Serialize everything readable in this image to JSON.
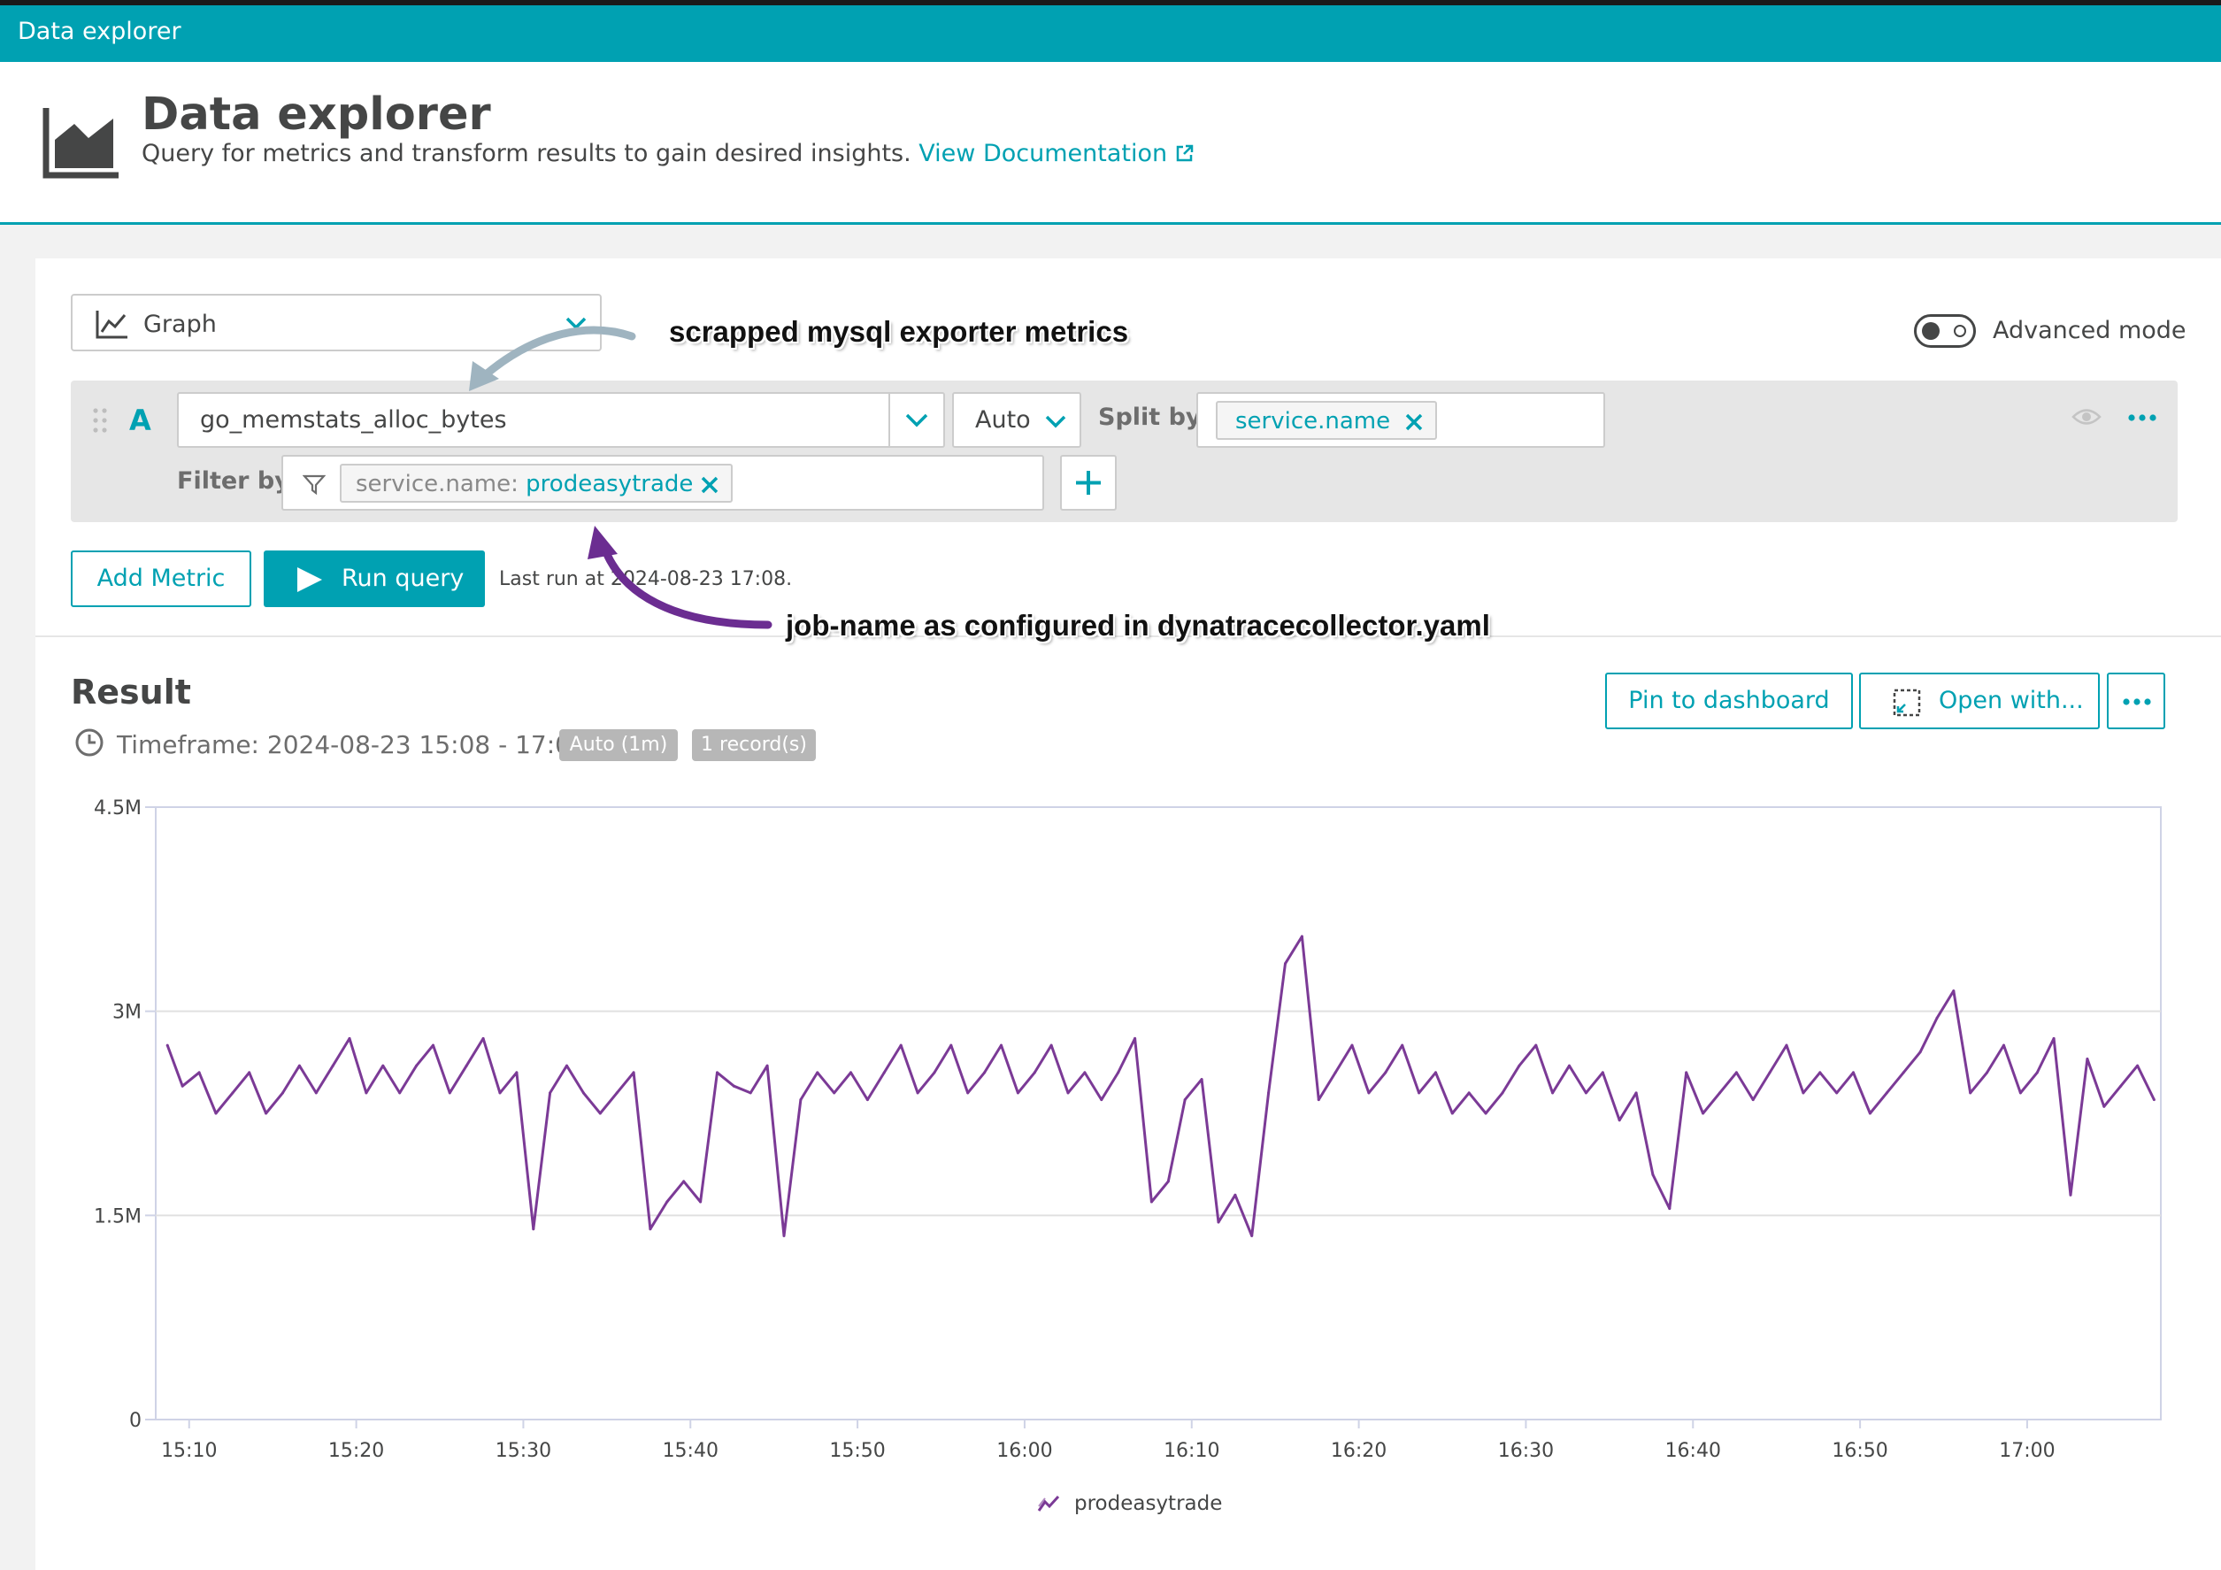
{
  "topbar": {
    "title": "Data explorer"
  },
  "header": {
    "title": "Data explorer",
    "description": "Query for metrics and transform results to gain desired insights.",
    "doc_link": "View Documentation"
  },
  "toolbar": {
    "visualization": "Graph",
    "advanced_mode_label": "Advanced mode",
    "advanced_mode_on": true
  },
  "query": {
    "letter": "A",
    "metric": "go_memstats_alloc_bytes",
    "aggregation": "Auto",
    "split_by_label": "Split by",
    "split_by_value": "service.name",
    "filter_label": "Filter by",
    "filter_key": "service.name:",
    "filter_value": "prodeasytrade"
  },
  "actions": {
    "add_metric": "Add Metric",
    "run_query": "Run query",
    "last_run": "Last run at 2024-08-23 17:08."
  },
  "annotations": {
    "metric_note": "scrapped mysql exporter metrics",
    "filter_note": "job-name as configured in dynatracecollector.yaml"
  },
  "result": {
    "title": "Result",
    "timeframe": "Timeframe: 2024-08-23 15:08 - 17:08",
    "badge_resolution": "Auto (1m)",
    "badge_records": "1 record(s)",
    "pin_button": "Pin to dashboard",
    "open_button": "Open with..."
  },
  "colors": {
    "accent": "#00a1b2",
    "series": "#7b3a96",
    "annotation_arrow_gray": "#9fb4c0",
    "annotation_arrow_purple": "#6b2d91"
  },
  "chart_data": {
    "type": "line",
    "xlabel": "",
    "ylabel": "",
    "y_ticks": [
      "0",
      "1.5M",
      "3M",
      "4.5M"
    ],
    "y_tick_values": [
      0,
      1500000,
      3000000,
      4500000
    ],
    "ylim": [
      0,
      4500000
    ],
    "x_ticks": [
      "15:10",
      "15:20",
      "15:30",
      "15:40",
      "15:50",
      "16:00",
      "16:10",
      "16:20",
      "16:30",
      "16:40",
      "16:50",
      "17:00"
    ],
    "x_tick_minutes": [
      2,
      12,
      22,
      32,
      42,
      52,
      62,
      72,
      82,
      92,
      102,
      112
    ],
    "x_unit_note": "minutes after 15:08",
    "xlim": [
      0,
      120
    ],
    "grid": true,
    "legend_position": "bottom-center",
    "series": [
      {
        "name": "prodeasytrade",
        "x": [
          0.7,
          1.6,
          2.6,
          3.6,
          4.6,
          5.6,
          6.6,
          7.6,
          8.6,
          9.6,
          10.6,
          11.6,
          12.6,
          13.6,
          14.6,
          15.6,
          16.6,
          17.6,
          18.6,
          19.6,
          20.6,
          21.6,
          22.6,
          23.6,
          24.6,
          25.6,
          26.6,
          27.6,
          28.6,
          29.6,
          30.6,
          31.6,
          32.6,
          33.6,
          34.6,
          35.6,
          36.6,
          37.6,
          38.6,
          39.6,
          40.6,
          41.6,
          42.6,
          43.6,
          44.6,
          45.6,
          46.6,
          47.6,
          48.6,
          49.6,
          50.6,
          51.6,
          52.6,
          53.6,
          54.6,
          55.6,
          56.6,
          57.6,
          58.6,
          59.6,
          60.6,
          61.6,
          62.6,
          63.6,
          64.6,
          65.6,
          66.6,
          67.6,
          68.6,
          69.6,
          70.6,
          71.6,
          72.6,
          73.6,
          74.6,
          75.6,
          76.6,
          77.6,
          78.6,
          79.6,
          80.6,
          81.6,
          82.6,
          83.6,
          84.6,
          85.6,
          86.6,
          87.6,
          88.6,
          89.6,
          90.6,
          91.6,
          92.6,
          93.6,
          94.6,
          95.6,
          96.6,
          97.6,
          98.6,
          99.6,
          100.6,
          101.6,
          102.6,
          103.6,
          104.6,
          105.6,
          106.6,
          107.6,
          108.6,
          109.6,
          110.6,
          111.6,
          112.6,
          113.6,
          114.6,
          115.6,
          116.6,
          117.6,
          118.6,
          119.6
        ],
        "values": [
          2750000,
          2450000,
          2550000,
          2250000,
          2400000,
          2550000,
          2250000,
          2400000,
          2600000,
          2400000,
          2600000,
          2800000,
          2400000,
          2600000,
          2400000,
          2600000,
          2750000,
          2400000,
          2600000,
          2800000,
          2400000,
          2550000,
          1400000,
          2400000,
          2600000,
          2400000,
          2250000,
          2400000,
          2550000,
          1400000,
          1600000,
          1750000,
          1600000,
          2550000,
          2450000,
          2400000,
          2600000,
          1350000,
          2350000,
          2550000,
          2400000,
          2550000,
          2350000,
          2550000,
          2750000,
          2400000,
          2550000,
          2750000,
          2400000,
          2550000,
          2750000,
          2400000,
          2550000,
          2750000,
          2400000,
          2550000,
          2350000,
          2550000,
          2800000,
          1600000,
          1750000,
          2350000,
          2500000,
          1450000,
          1650000,
          1350000,
          2400000,
          3350000,
          3550000,
          2350000,
          2550000,
          2750000,
          2400000,
          2550000,
          2750000,
          2400000,
          2550000,
          2250000,
          2400000,
          2250000,
          2400000,
          2600000,
          2750000,
          2400000,
          2600000,
          2400000,
          2550000,
          2200000,
          2400000,
          1800000,
          1550000,
          2550000,
          2250000,
          2400000,
          2550000,
          2350000,
          2550000,
          2750000,
          2400000,
          2550000,
          2400000,
          2550000,
          2250000,
          2400000,
          2550000,
          2700000,
          2950000,
          3150000,
          2400000,
          2550000,
          2750000,
          2400000,
          2550000,
          2800000,
          1650000,
          2650000,
          2300000,
          2450000,
          2600000,
          2350000
        ]
      }
    ]
  }
}
